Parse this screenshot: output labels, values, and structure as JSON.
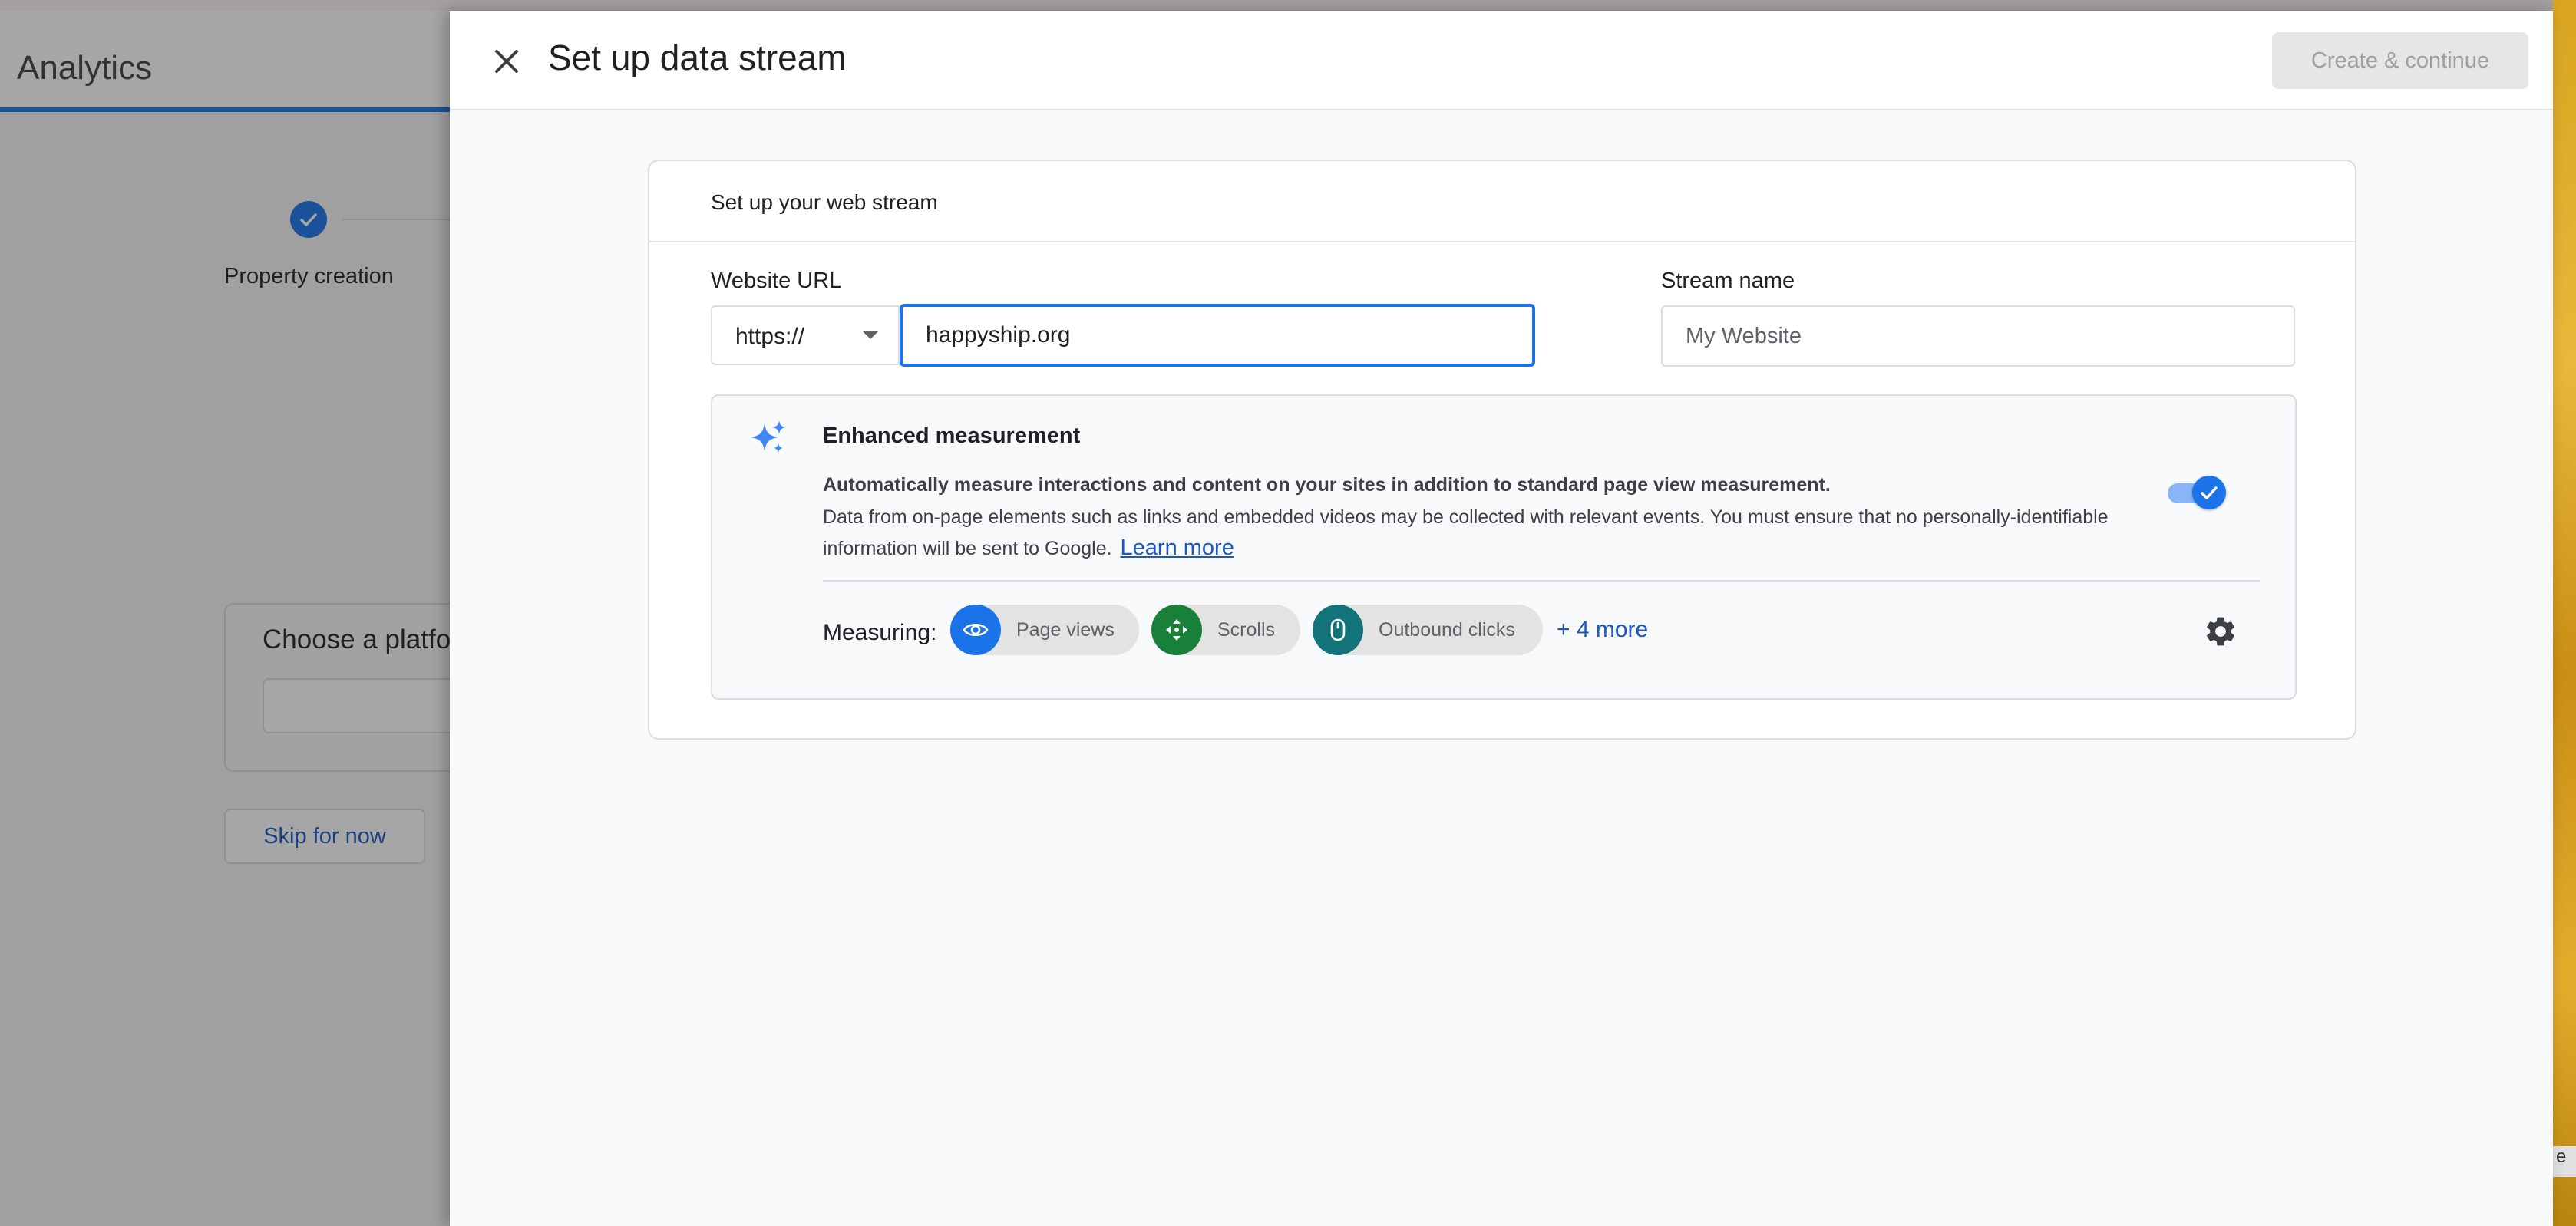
{
  "app": {
    "title": "Analytics"
  },
  "stepper": {
    "step1_label": "Property creation"
  },
  "platform": {
    "title": "Choose a platform"
  },
  "skip_button": "Skip for now",
  "drawer": {
    "title": "Set up data stream",
    "create_button": "Create & continue",
    "card_title": "Set up your web stream",
    "website_url_label": "Website URL",
    "protocol": "https://",
    "url_value": "happyship.org",
    "stream_name_label": "Stream name",
    "stream_name_placeholder": "My Website",
    "enhanced": {
      "title": "Enhanced measurement",
      "desc_bold": "Automatically measure interactions and content on your sites in addition to standard page view measurement.",
      "desc": "Data from on-page elements such as links and embedded videos may be collected with relevant events. You must ensure that no personally-identifiable information will be sent to Google.",
      "learn_more": "Learn more",
      "toggle_on": true,
      "measuring_label": "Measuring:",
      "chips": [
        {
          "label": "Page views",
          "icon": "eye-icon",
          "color": "#1a73e8"
        },
        {
          "label": "Scrolls",
          "icon": "scroll-icon",
          "color": "#188038"
        },
        {
          "label": "Outbound clicks",
          "icon": "mouse-icon",
          "color": "#12737a"
        }
      ],
      "more": "+ 4 more"
    }
  },
  "edge_text": "e",
  "colors": {
    "accent": "#1a73e8",
    "link": "#1a57c0",
    "disabled_button": "#e6e6e6"
  }
}
